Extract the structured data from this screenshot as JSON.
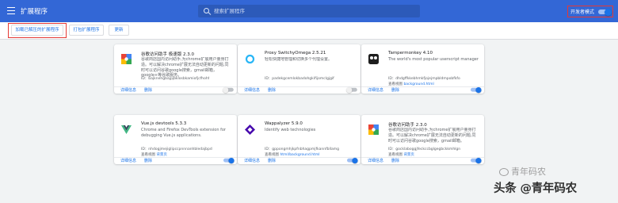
{
  "header": {
    "title": "扩展程序",
    "search_placeholder": "搜索扩展程序",
    "dev_mode_label": "开发者模式",
    "dev_mode_on": true
  },
  "toolbar": {
    "load_unpacked": "加载已解压的扩展程序",
    "pack": "打包扩展程序",
    "update": "更新"
  },
  "labels": {
    "details": "详细信息",
    "remove": "删除",
    "id_prefix": "ID：",
    "view_prefix": "查看视图"
  },
  "extensions": [
    {
      "name": "谷歌访问助手 极速版 2.3.0",
      "desc": "谷歌商店国内访问助手,为chrome扩展用户量身打造。可以解决chrome扩展无法自动更新的问题,同时可以访问谷歌google搜索，gmail邮箱，google+等谷歌服务。",
      "id": "bajknehgbajpjbklosbkamiofjcfhohf",
      "view": "",
      "enabled": false,
      "icon": "puzzle-icon"
    },
    {
      "name": "Proxy SwitchyOmega 2.5.21",
      "desc": "轻松快捷地管理和切换多个代理设置。",
      "id": "padekgcemlokbadohgkifijomclgjgif",
      "view": "",
      "enabled": false,
      "icon": "ring-icon"
    },
    {
      "name": "Tampermonkey 4.10",
      "desc": "The world's most popular userscript manager",
      "id": "dhdgffkkebhmkfjojejmpbldmpobfkfo",
      "view": "background.html",
      "enabled": true,
      "icon": "tampermonkey-icon"
    },
    {
      "name": "Vue.js devtools 5.3.3",
      "desc": "Chrome and Firefox DevTools extension for debugging Vue.js applications.",
      "id": "nhdogjmejiglipccpnnnanhbledajbpd",
      "view": "背景页",
      "enabled": true,
      "icon": "vue-icon"
    },
    {
      "name": "Wappalyzer 5.9.0",
      "desc": "Identify web technologies",
      "id": "gppongmhjkpfnbhagpmjfkannfbllamg",
      "view": "html/background.html",
      "enabled": true,
      "icon": "wappalyzer-icon"
    },
    {
      "name": "谷歌访问助手 2.3.0",
      "desc": "谷歌商店国内访问助手,为chrome扩展用户量身打造。可以解决chrome扩展无法自动更新的问题,同时可以访问谷歌google搜索，gmail邮箱。",
      "id": "gocklaboggjfeckccbglgegbckkmhlgn",
      "view": "背景页",
      "enabled": true,
      "icon": "puzzle-icon"
    }
  ],
  "watermark": "青年码农",
  "footer_text": "头条 @青年码农",
  "colors": {
    "header": "#3367d6",
    "accent": "#1a73e8",
    "highlight": "#e53935"
  }
}
